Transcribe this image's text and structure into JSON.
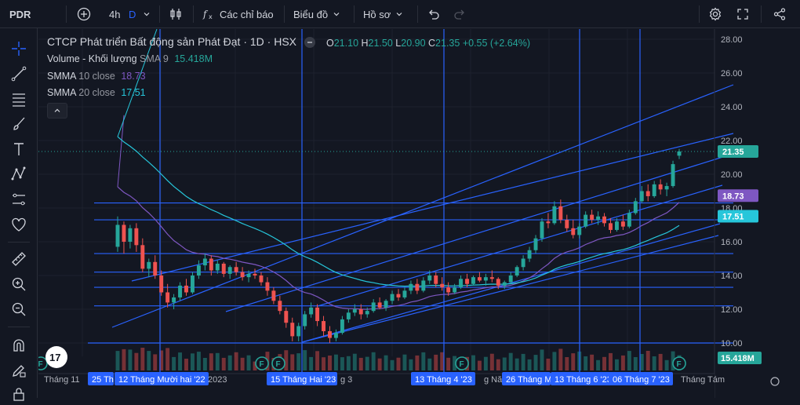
{
  "toolbar": {
    "symbol": "PDR",
    "interval": "4h",
    "interval_active": "D",
    "indicators_label": "Các chỉ báo",
    "chart_type_label": "Biểu đồ",
    "profile_label": "Hồ sơ"
  },
  "legend": {
    "title": "CTCP Phát triển Bất động sản Phát Đạt · 1D · HSX",
    "o_label": "O",
    "o_value": "21.10",
    "h_label": "H",
    "h_value": "21.50",
    "l_label": "L",
    "l_value": "20.90",
    "c_label": "C",
    "c_value": "21.35",
    "change": "+0.55 (+2.64%)",
    "volume_label": "Volume - Khối lượng",
    "volume_ma": "SMA 9",
    "volume_value": "15.418M",
    "smma10_label": "SMMA",
    "smma10_param": "10 close",
    "smma10_value": "18.73",
    "smma20_label": "SMMA",
    "smma20_param": "20 close",
    "smma20_value": "17.51"
  },
  "colors": {
    "up": "#26a69a",
    "down": "#ef5350",
    "smma10": "#7e57c2",
    "smma20": "#26c6da",
    "drawing": "#2962ff",
    "price_badge": "#26a69a",
    "smma10_badge": "#7e57c2",
    "smma20_badge": "#26c6da"
  },
  "chart_data": {
    "type": "candlestick",
    "y_axis": {
      "ticks": [
        "28.00",
        "26.00",
        "24.00",
        "22.00",
        "20.00",
        "18.00",
        "16.00",
        "14.00",
        "12.00",
        "10.00"
      ],
      "range": [
        9.2,
        28.6
      ]
    },
    "price_badges": [
      "21.35",
      "18.73",
      "17.51",
      "15.418M"
    ],
    "x_labels": [
      "Tháng 11",
      "25 Th",
      "12 Tháng Mười hai '22",
      "2023",
      "15 Tháng Hai '23",
      "g 3",
      "13 Tháng 4 '23",
      "g Năm",
      "26 Tháng M",
      "13 Tháng 6 '23",
      "06 Tháng 7 '23",
      "Tháng Tám"
    ],
    "candles": [
      [
        15.7,
        17.5,
        15.4,
        17.0
      ],
      [
        17.0,
        17.2,
        15.3,
        16.0
      ],
      [
        16.0,
        17.0,
        15.6,
        16.8
      ],
      [
        16.8,
        17.1,
        15.4,
        15.8
      ],
      [
        15.8,
        16.2,
        14.2,
        14.4
      ],
      [
        14.4,
        15.0,
        13.9,
        14.8
      ],
      [
        14.8,
        15.2,
        13.8,
        14.0
      ],
      [
        14.0,
        14.3,
        12.8,
        13.0
      ],
      [
        13.0,
        13.5,
        12.1,
        12.4
      ],
      [
        12.4,
        12.9,
        12.0,
        12.7
      ],
      [
        12.7,
        13.6,
        12.5,
        13.4
      ],
      [
        13.4,
        13.8,
        12.8,
        13.0
      ],
      [
        13.0,
        14.2,
        12.9,
        14.0
      ],
      [
        14.0,
        14.9,
        13.8,
        14.6
      ],
      [
        14.6,
        15.3,
        14.3,
        15.0
      ],
      [
        15.0,
        15.2,
        14.0,
        14.3
      ],
      [
        14.3,
        14.9,
        14.1,
        14.7
      ],
      [
        14.7,
        14.8,
        13.9,
        14.1
      ],
      [
        14.1,
        14.6,
        13.8,
        14.5
      ],
      [
        14.5,
        14.8,
        14.0,
        14.2
      ],
      [
        14.2,
        14.5,
        13.7,
        13.9
      ],
      [
        13.9,
        14.3,
        13.6,
        14.1
      ],
      [
        14.1,
        14.4,
        13.8,
        14.0
      ],
      [
        14.0,
        14.2,
        13.4,
        13.6
      ],
      [
        13.6,
        13.9,
        12.8,
        13.1
      ],
      [
        13.1,
        13.3,
        12.3,
        12.5
      ],
      [
        12.5,
        12.8,
        11.7,
        11.9
      ],
      [
        11.9,
        12.1,
        10.9,
        11.2
      ],
      [
        11.2,
        11.5,
        10.1,
        10.4
      ],
      [
        10.4,
        11.2,
        10.1,
        11.0
      ],
      [
        11.0,
        11.9,
        10.8,
        11.7
      ],
      [
        11.7,
        12.4,
        11.5,
        12.1
      ],
      [
        12.1,
        12.3,
        11.0,
        11.3
      ],
      [
        11.3,
        11.6,
        10.4,
        10.7
      ],
      [
        10.7,
        11.0,
        10.0,
        10.3
      ],
      [
        10.3,
        10.8,
        10.1,
        10.6
      ],
      [
        10.6,
        11.6,
        10.5,
        11.4
      ],
      [
        11.4,
        12.0,
        11.2,
        11.8
      ],
      [
        11.8,
        12.3,
        11.6,
        12.0
      ],
      [
        12.0,
        12.3,
        11.4,
        11.7
      ],
      [
        11.7,
        12.1,
        11.5,
        11.9
      ],
      [
        11.9,
        12.6,
        11.8,
        12.4
      ],
      [
        12.4,
        12.7,
        12.0,
        12.1
      ],
      [
        12.1,
        12.6,
        11.9,
        12.5
      ],
      [
        12.5,
        13.1,
        12.3,
        12.9
      ],
      [
        12.9,
        13.2,
        12.5,
        12.7
      ],
      [
        12.7,
        13.3,
        12.6,
        13.1
      ],
      [
        13.1,
        13.7,
        12.9,
        13.5
      ],
      [
        13.5,
        13.8,
        12.9,
        13.1
      ],
      [
        13.1,
        13.9,
        13.0,
        13.7
      ],
      [
        13.7,
        14.3,
        13.5,
        14.0
      ],
      [
        14.0,
        14.2,
        13.3,
        13.5
      ],
      [
        13.5,
        13.9,
        13.1,
        13.3
      ],
      [
        13.3,
        13.6,
        12.8,
        13.0
      ],
      [
        13.0,
        13.5,
        12.9,
        13.3
      ],
      [
        13.3,
        14.0,
        13.2,
        13.8
      ],
      [
        13.8,
        14.1,
        13.3,
        13.5
      ],
      [
        13.5,
        14.0,
        13.4,
        13.9
      ],
      [
        13.9,
        14.2,
        13.6,
        13.7
      ],
      [
        13.7,
        14.1,
        13.4,
        13.9
      ],
      [
        13.9,
        14.3,
        13.6,
        13.8
      ],
      [
        13.8,
        13.9,
        13.2,
        13.4
      ],
      [
        13.4,
        13.7,
        13.2,
        13.6
      ],
      [
        13.6,
        14.2,
        13.5,
        14.0
      ],
      [
        14.0,
        14.6,
        13.9,
        14.5
      ],
      [
        14.5,
        15.2,
        14.3,
        15.0
      ],
      [
        15.0,
        15.7,
        14.8,
        15.5
      ],
      [
        15.5,
        16.4,
        15.3,
        16.2
      ],
      [
        16.2,
        17.4,
        16.0,
        17.2
      ],
      [
        17.2,
        17.7,
        16.8,
        17.1
      ],
      [
        17.1,
        18.4,
        17.0,
        18.1
      ],
      [
        18.1,
        18.5,
        17.1,
        17.3
      ],
      [
        17.3,
        17.6,
        16.6,
        16.8
      ],
      [
        16.8,
        17.3,
        16.2,
        16.4
      ],
      [
        16.4,
        17.1,
        16.2,
        16.9
      ],
      [
        16.9,
        17.8,
        16.8,
        17.6
      ],
      [
        17.6,
        17.9,
        17.1,
        17.3
      ],
      [
        17.3,
        17.8,
        17.0,
        17.5
      ],
      [
        17.5,
        17.7,
        16.9,
        17.1
      ],
      [
        17.1,
        17.4,
        16.5,
        16.7
      ],
      [
        16.7,
        17.4,
        16.6,
        17.2
      ],
      [
        17.2,
        17.6,
        16.7,
        16.9
      ],
      [
        16.9,
        17.9,
        16.8,
        17.7
      ],
      [
        17.7,
        18.6,
        17.6,
        18.4
      ],
      [
        18.4,
        19.3,
        18.3,
        19.0
      ],
      [
        19.0,
        19.4,
        18.4,
        18.7
      ],
      [
        18.7,
        19.6,
        18.6,
        19.4
      ],
      [
        19.4,
        19.7,
        18.8,
        19.1
      ],
      [
        19.1,
        19.5,
        18.7,
        19.3
      ],
      [
        19.3,
        20.8,
        19.2,
        20.6
      ],
      [
        21.1,
        21.5,
        20.9,
        21.35
      ]
    ],
    "volume_ma_value": 15418000
  }
}
